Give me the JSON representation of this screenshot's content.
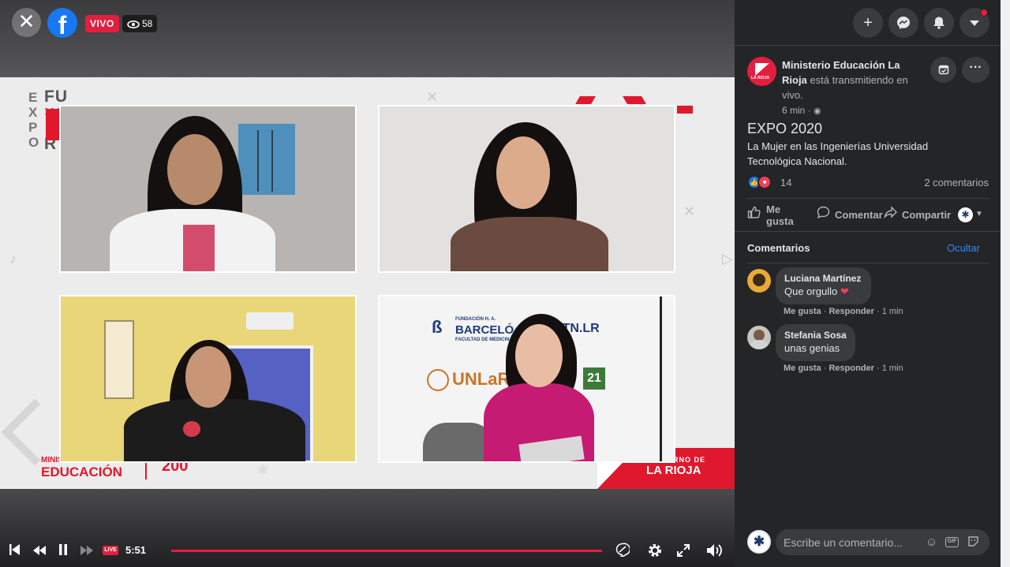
{
  "video": {
    "live_label": "VIVO",
    "viewer_count": "58",
    "time": "5:51",
    "live_mini": "LIVE",
    "stage": {
      "expo_vertical": "EXPO",
      "fu_text": "FU",
      "r_text": "R",
      "ministerio_small": "MINISTERIO DE",
      "ministerio_big": "EDUCACIÓN",
      "rioja_small": "GOBIERNO DE",
      "rioja_big": "LA RIOJA",
      "fund_title": "FUNDACIÓN H. A.",
      "fund_name": "BARCELÓ",
      "fund_sub": "FACULTAD DE MEDICINA",
      "utn": "UTN.LR",
      "unlar": "UNLaR"
    }
  },
  "sidebar": {
    "page_name": "Ministerio Educación La Rioja",
    "status_text": "está transmitiendo en vivo.",
    "time_ago": "6 min ·",
    "title": "EXPO 2020",
    "description": "La Mujer en las Ingenierías Universidad Tecnológica Nacional.",
    "reaction_count": "14",
    "comment_count": "2 comentarios",
    "actions": {
      "like": "Me gusta",
      "comment": "Comentar",
      "share": "Compartir"
    },
    "comments_label": "Comentarios",
    "hide_label": "Ocultar",
    "comments": [
      {
        "author": "Luciana Martínez",
        "text": "Que orgullo",
        "like": "Me gusta",
        "reply": "Responder",
        "time": "1 min"
      },
      {
        "author": "Stefania Sosa",
        "text": "unas genias",
        "like": "Me gusta",
        "reply": "Responder",
        "time": "1 min"
      }
    ],
    "comment_placeholder": "Escribe un comentario...",
    "gif_label": "GIF"
  },
  "colors": {
    "accent": "#e41e3f",
    "link": "#2d88ff",
    "facebook": "#1877f2"
  }
}
